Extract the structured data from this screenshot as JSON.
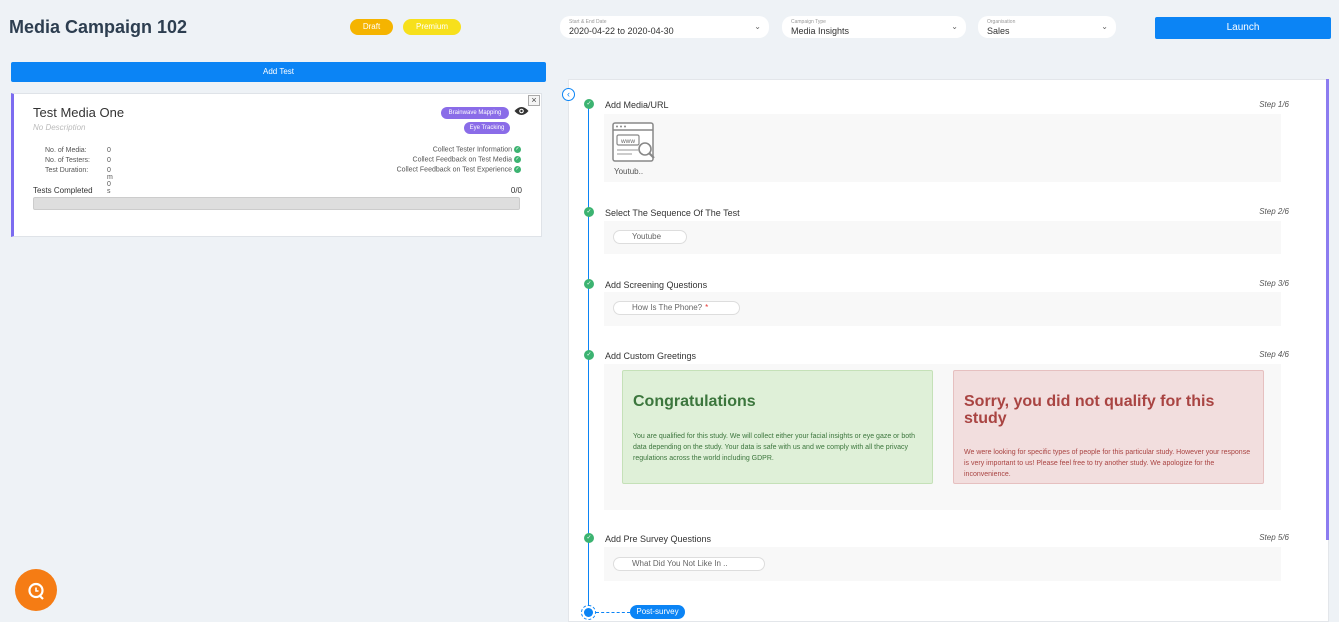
{
  "header": {
    "title": "Media Campaign 102",
    "badges": {
      "draft": "Draft",
      "premium": "Premium"
    },
    "date_select": {
      "label": "Start & End Date",
      "value": "2020-04-22 to 2020-04-30"
    },
    "type_select": {
      "label": "Campaign Type",
      "value": "Media Insights"
    },
    "org_select": {
      "label": "Organisation",
      "value": "Sales"
    },
    "launch_label": "Launch"
  },
  "left": {
    "add_test_label": "Add Test",
    "card": {
      "close_glyph": "×",
      "name": "Test Media One",
      "description": "No Description",
      "tags": [
        "Brainwave Mapping",
        "Eye Tracking"
      ],
      "stats": [
        {
          "label": "No. of Media:",
          "value": "0"
        },
        {
          "label": "No. of Testers:",
          "value": "0"
        },
        {
          "label": "Test Duration:",
          "value": "0 m 0 s"
        }
      ],
      "features": [
        "Collect Tester Information",
        "Collect Feedback on Test Media",
        "Collect Feedback on Test Experience"
      ],
      "tests_completed_label": "Tests Completed",
      "tests_completed_count": "0/0",
      "progress_fraction": 0
    }
  },
  "steps": [
    {
      "title": "Add Media/URL",
      "step": "Step 1/6",
      "media_label": "Youtub.."
    },
    {
      "title": "Select The Sequence Of The Test",
      "step": "Step 2/6",
      "chip": "Youtube"
    },
    {
      "title": "Add Screening Questions",
      "step": "Step 3/6",
      "chip": "How Is The Phone?",
      "required_mark": "*"
    },
    {
      "title": "Add Custom Greetings",
      "step": "Step 4/6"
    },
    {
      "title": "Add Pre Survey Questions",
      "step": "Step 5/6",
      "chip": "What Did You Not Like In .."
    }
  ],
  "greetings": {
    "success": {
      "heading": "Congratulations",
      "body": "You are qualified for this study. We will collect either your facial insights or eye gaze or both data depending on the study. Your data is safe with us and we comply with all the privacy regulations across the world including GDPR."
    },
    "failure": {
      "heading": "Sorry, you did not qualify for this study",
      "body": "We were looking for specific types of people for this particular study. However your response is very important to us! Please feel free to try another study. We apologize for the inconvenience."
    }
  },
  "post_survey_label": "Post-survey",
  "colors": {
    "accent": "#0b84f5",
    "success": "#3cb371",
    "draft": "#f5b400",
    "premium": "#f7e01c",
    "tag": "#8a6ce8",
    "fab": "#f57c14"
  },
  "icons": [
    "chevron-down-icon",
    "eye-icon",
    "check-circle-icon",
    "chevron-left-icon",
    "www-icon",
    "chat-icon",
    "close-icon"
  ]
}
